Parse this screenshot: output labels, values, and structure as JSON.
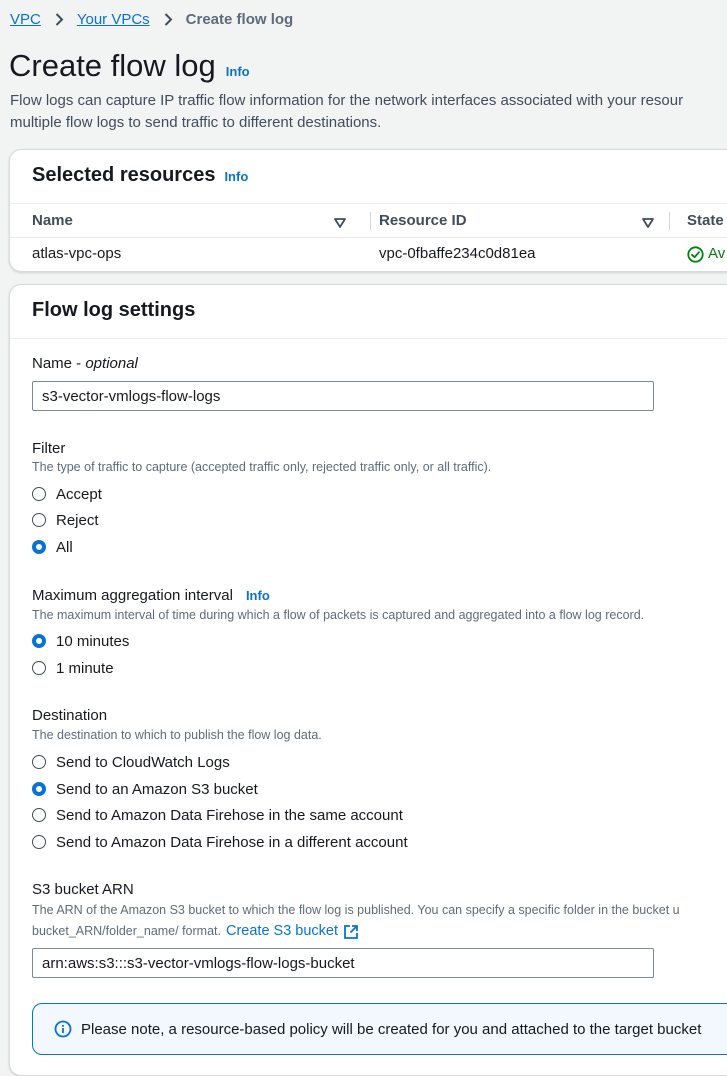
{
  "breadcrumb": {
    "items": [
      "VPC",
      "Your VPCs"
    ],
    "current": "Create flow log"
  },
  "header": {
    "title": "Create flow log",
    "info": "Info",
    "description_line1": "Flow logs can capture IP traffic flow information for the network interfaces associated with your resour",
    "description_line2": "multiple flow logs to send traffic to different destinations."
  },
  "selected_resources": {
    "title": "Selected resources",
    "info": "Info",
    "columns": [
      "Name",
      "Resource ID",
      "State"
    ],
    "rows": [
      {
        "name": "atlas-vpc-ops",
        "resource_id": "vpc-0fbaffe234c0d81ea",
        "state": "Av"
      }
    ]
  },
  "flow_log_settings": {
    "title": "Flow log settings",
    "name": {
      "label": "Name - ",
      "optional": "optional",
      "value": "s3-vector-vmlogs-flow-logs"
    },
    "filter": {
      "label": "Filter",
      "description": "The type of traffic to capture (accepted traffic only, rejected traffic only, or all traffic).",
      "options": [
        "Accept",
        "Reject",
        "All"
      ],
      "selected": "All"
    },
    "aggregation": {
      "label": "Maximum aggregation interval",
      "info": "Info",
      "description": "The maximum interval of time during which a flow of packets is captured and aggregated into a flow log record.",
      "options": [
        "10 minutes",
        "1 minute"
      ],
      "selected": "10 minutes"
    },
    "destination": {
      "label": "Destination",
      "description": "The destination to which to publish the flow log data.",
      "options": [
        "Send to CloudWatch Logs",
        "Send to an Amazon S3 bucket",
        "Send to Amazon Data Firehose in the same account",
        "Send to Amazon Data Firehose in a different account"
      ],
      "selected": "Send to an Amazon S3 bucket"
    },
    "s3_arn": {
      "label": "S3 bucket ARN",
      "description_line1": "The ARN of the Amazon S3 bucket to which the flow log is published. You can specify a specific folder in the bucket u",
      "description_line2": "bucket_ARN/folder_name/ format.",
      "create_link": "Create S3 bucket",
      "value": "arn:aws:s3:::s3-vector-vmlogs-flow-logs-bucket"
    },
    "notice": "Please note, a resource-based policy will be created for you and attached to the target bucket"
  },
  "colors": {
    "link": "#0972d3",
    "success": "#037f0c",
    "background": "#f2f3f3",
    "notice_bg": "#f2f8fd"
  }
}
